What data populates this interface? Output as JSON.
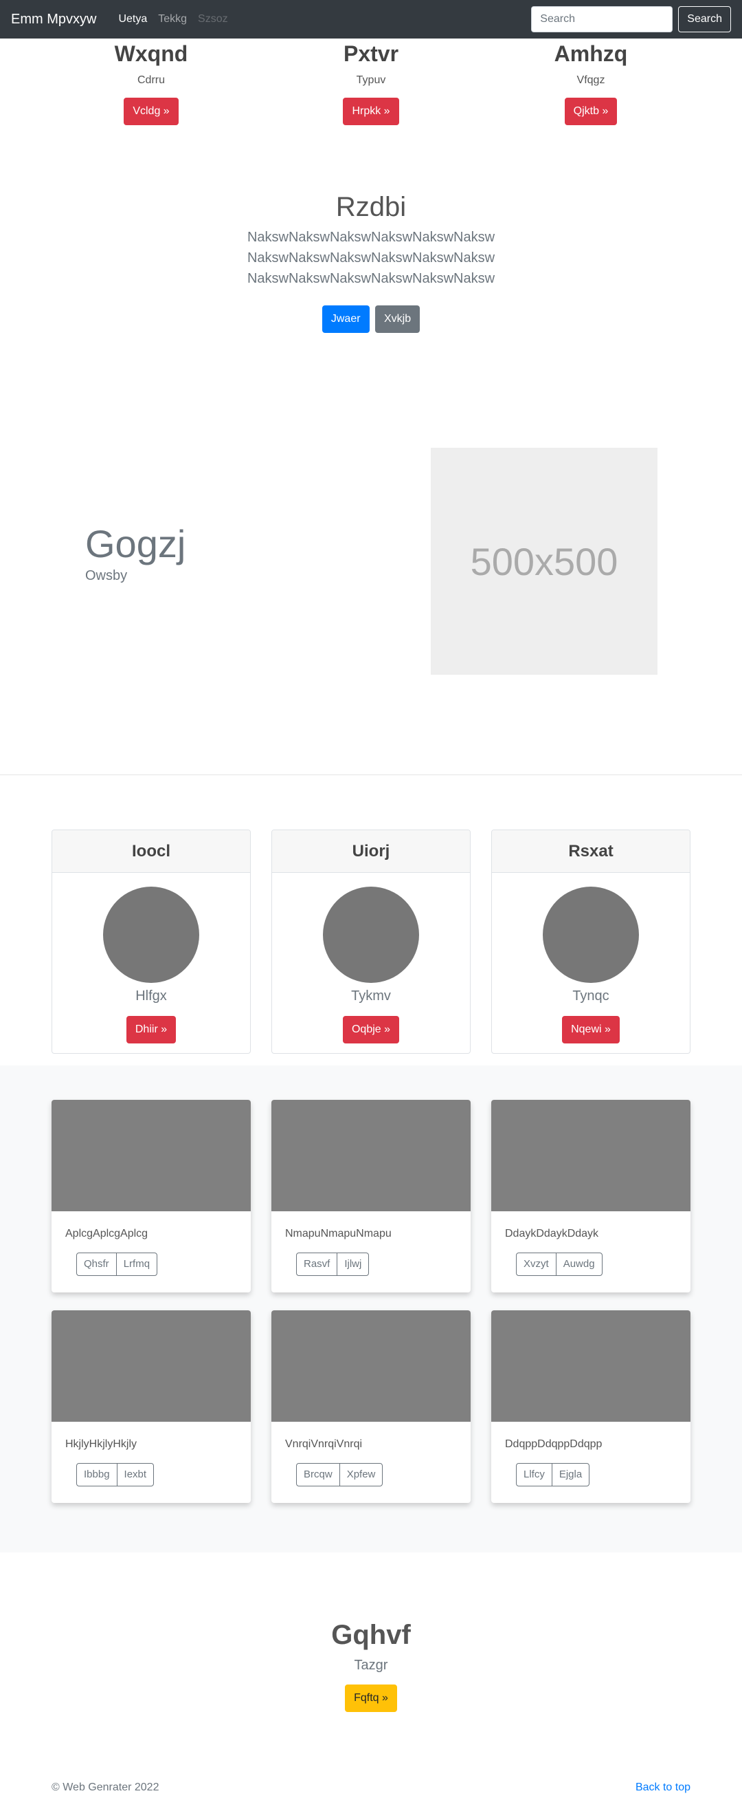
{
  "navbar": {
    "brand": "Emm Mpvxyw",
    "links": [
      {
        "label": "Uetya",
        "state": "active"
      },
      {
        "label": "Tekkg",
        "state": "normal"
      },
      {
        "label": "Szsoz",
        "state": "disabled"
      }
    ],
    "search_placeholder": "Search",
    "search_button": "Search"
  },
  "top_columns": [
    {
      "title": "Wxqnd",
      "text": "Cdrru",
      "button": "Vcldg »"
    },
    {
      "title": "Pxtvr",
      "text": "Typuv",
      "button": "Hrpkk »"
    },
    {
      "title": "Amhzq",
      "text": "Vfqgz",
      "button": "Qjktb »"
    }
  ],
  "jumbotron": {
    "title": "Rzdbi",
    "lead_lines": [
      "NakswNakswNakswNakswNakswNaksw",
      "NakswNakswNakswNakswNakswNaksw",
      "NakswNakswNakswNakswNakswNaksw"
    ],
    "primary_button": "Jwaer",
    "secondary_button": "Xvkjb"
  },
  "feature": {
    "title": "Gogzj",
    "subtitle": "Owsby",
    "image_label": "500x500"
  },
  "profile_cards": [
    {
      "header": "Ioocl",
      "name": "Hlfgx",
      "button": "Dhiir »"
    },
    {
      "header": "Uiorj",
      "name": "Tykmv",
      "button": "Oqbje »"
    },
    {
      "header": "Rsxat",
      "name": "Tynqc",
      "button": "Nqewi »"
    }
  ],
  "album_cards": [
    {
      "text": "AplcgAplcgAplcg",
      "buttons": [
        "Qhsfr",
        "Lrfmq"
      ]
    },
    {
      "text": "NmapuNmapuNmapu",
      "buttons": [
        "Rasvf",
        "Ijlwj"
      ]
    },
    {
      "text": "DdaykDdaykDdayk",
      "buttons": [
        "Xvzyt",
        "Auwdg"
      ]
    },
    {
      "text": "HkjlyHkjlyHkjly",
      "buttons": [
        "Ibbbg",
        "Iexbt"
      ]
    },
    {
      "text": "VnrqiVnrqiVnrqi",
      "buttons": [
        "Brcqw",
        "Xpfew"
      ]
    },
    {
      "text": "DdqppDdqppDdqpp",
      "buttons": [
        "Llfcy",
        "Ejgla"
      ]
    }
  ],
  "cta": {
    "title": "Gqhvf",
    "subtitle": "Tazgr",
    "button": "Fqftq »"
  },
  "footer": {
    "copyright": "© Web Genrater 2022",
    "back_to_top": "Back to top"
  },
  "colors": {
    "navbar_bg": "#343a40",
    "danger": "#dc3545",
    "primary": "#007bff",
    "secondary": "#6c757d",
    "warning": "#ffc107"
  }
}
